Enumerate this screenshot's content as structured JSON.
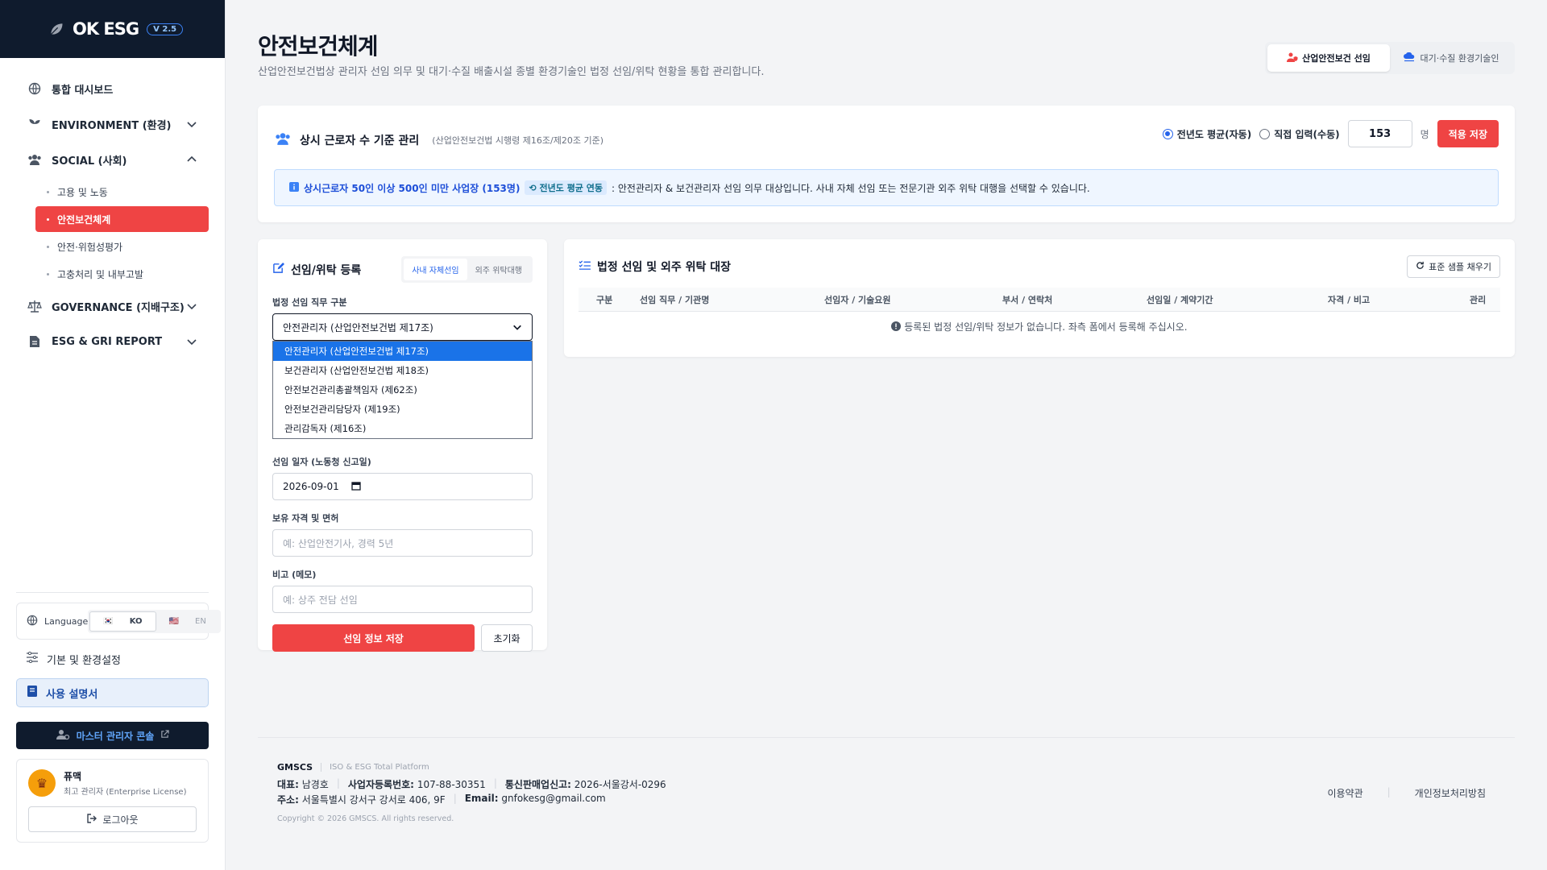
{
  "brand": {
    "name": "OK ESG",
    "version": "V 2.5"
  },
  "sidebar": {
    "items": [
      {
        "label": "통합 대시보드"
      },
      {
        "label": "ENVIRONMENT (환경)"
      },
      {
        "label": "SOCIAL (사회)"
      },
      {
        "label": "GOVERNANCE (지배구조)"
      },
      {
        "label": "ESG & GRI REPORT"
      }
    ],
    "social_sub": [
      {
        "label": "고용 및 노동"
      },
      {
        "label": "안전보건체계"
      },
      {
        "label": "안전·위험성평가"
      },
      {
        "label": "고충처리 및 내부고발"
      }
    ],
    "language_label": "Language",
    "lang_ko": "KO",
    "lang_en": "EN",
    "settings_label": "기본 및 환경설정",
    "manual_label": "사용 설명서",
    "master_label": "마스터 관리자 콘솔",
    "user_name": "퓨맥",
    "user_role": "최고 관리자 (Enterprise License)",
    "logout_label": "로그아웃"
  },
  "header": {
    "title": "안전보건체계",
    "description": "산업안전보건법상 관리자 선임 의무 및 대기·수질 배출시설 종별 환경기술인 법정 선임/위탁 현황을 통합 관리합니다.",
    "tabs": [
      {
        "label": "산업안전보건 선임"
      },
      {
        "label": "대기·수질 환경기술인"
      }
    ]
  },
  "workers": {
    "title": "상시 근로자 수 기준 관리",
    "subtitle": "(산업안전보건법 시행령 제16조/제20조 기준)",
    "radio_auto": "전년도 평균(자동)",
    "radio_manual": "직접 입력(수동)",
    "count": "153",
    "unit": "명",
    "save_label": "적용 저장",
    "info_highlight": "상시근로자 50인 이상 500인 미만 사업장 (153명)",
    "info_tag": "전년도 평균 연동",
    "info_text": ": 안전관리자 & 보건관리자 선임 의무 대상입니다. 사내 자체 선임 또는 전문기관 외주 위탁 대행을 선택할 수 있습니다."
  },
  "form": {
    "title": "선임/위탁 등록",
    "seg_internal": "사내 자체선임",
    "seg_outsource": "외주 위탁대행",
    "role_label": "법정 선임 직무 구분",
    "role_selected": "안전관리자 (산업안전보건법 제17조)",
    "role_options": [
      "안전관리자 (산업안전보건법 제17조)",
      "보건관리자 (산업안전보건법 제18조)",
      "안전보건관리총괄책임자 (제62조)",
      "안전보건관리담당자 (제19조)",
      "관리감독자 (제16조)"
    ],
    "date_label": "선임 일자 (노동청 신고일)",
    "date_value": "2026-09-01",
    "qual_label": "보유 자격 및 면허",
    "qual_placeholder": "예: 산업안전기사, 경력 5년",
    "memo_label": "비고 (메모)",
    "memo_placeholder": "예: 상주 전담 선임",
    "save_label": "선임 정보 저장",
    "reset_label": "초기화"
  },
  "ledger": {
    "title": "법정 선임 및 외주 위탁 대장",
    "fill_label": "표준 샘플 채우기",
    "columns": [
      "구분",
      "선임 직무 / 기관명",
      "선임자 / 기술요원",
      "부서 / 연락처",
      "선임일 / 계약기간",
      "자격 / 비고",
      "관리"
    ],
    "empty_text": "등록된 법정 선임/위탁 정보가 없습니다. 좌측 폼에서 등록해 주십시오."
  },
  "footer": {
    "company": "GMSCS",
    "tagline": "ISO & ESG Total Platform",
    "ceo_label": "대표:",
    "ceo": "남경호",
    "biz_label": "사업자등록번호:",
    "biz": "107-88-30351",
    "mail_order_label": "통신판매업신고:",
    "mail_order": "2026-서울강서-0296",
    "addr_label": "주소:",
    "addr": "서울특별시 강서구 강서로 406, 9F",
    "email_label": "Email:",
    "email": "gnfokesg@gmail.com",
    "copyright": "Copyright © 2026 GMSCS. All rights reserved.",
    "terms": "이용약관",
    "privacy": "개인정보처리방침"
  },
  "colors": {
    "accent_red": "#ef4444",
    "brand_dark": "#0f1b2d",
    "accent_blue": "#2563eb"
  }
}
